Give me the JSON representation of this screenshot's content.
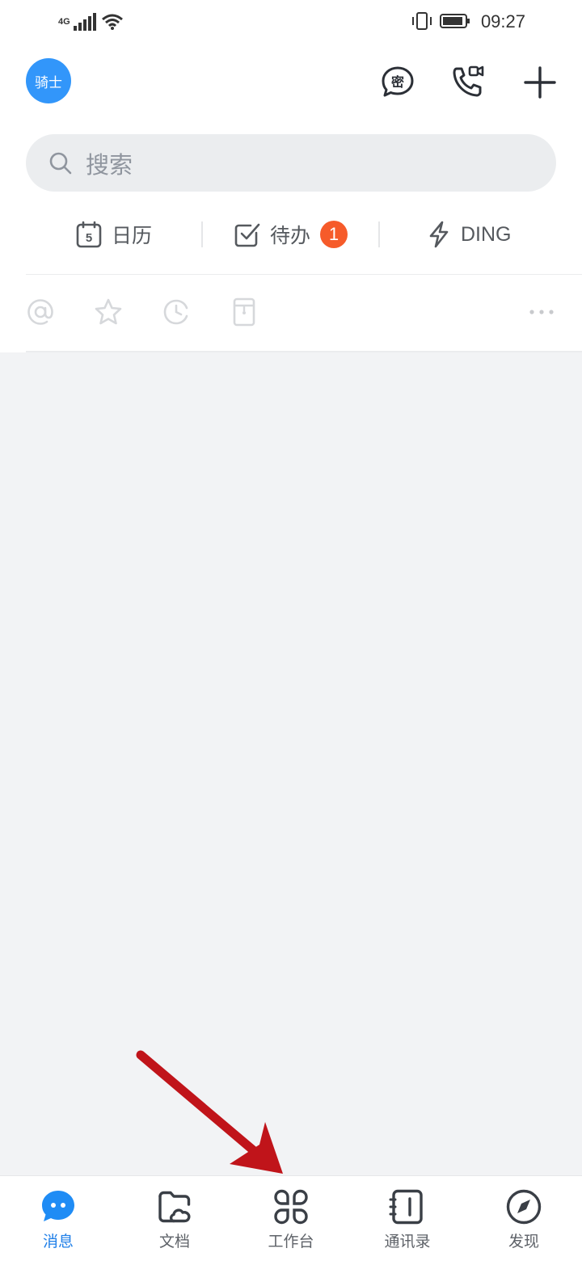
{
  "status_bar": {
    "network": "4G",
    "time": "09:27"
  },
  "header": {
    "avatar_text": "骑士",
    "icons": [
      "secret-chat-icon",
      "phone-video-icon",
      "plus-icon"
    ]
  },
  "search": {
    "placeholder": "搜索"
  },
  "quick": {
    "calendar": {
      "label": "日历",
      "icon_number": "5"
    },
    "todo": {
      "label": "待办",
      "badge": "1"
    },
    "ding": {
      "label": "DING"
    }
  },
  "filters": [
    "at-icon",
    "star-icon",
    "clock-icon",
    "bookmark-icon",
    "more-icon"
  ],
  "tabbar": {
    "items": [
      {
        "label": "消息",
        "icon": "message-icon",
        "active": true
      },
      {
        "label": "文档",
        "icon": "docs-folder-icon",
        "active": false
      },
      {
        "label": "工作台",
        "icon": "workbench-icon",
        "active": false
      },
      {
        "label": "通讯录",
        "icon": "contacts-icon",
        "active": false
      },
      {
        "label": "发现",
        "icon": "compass-icon",
        "active": false
      }
    ]
  },
  "colors": {
    "accent": "#3296fa",
    "tab_active": "#1f7fe8",
    "badge": "#f65b2a",
    "content_bg": "#f2f3f5",
    "annotation_arrow": "#c0141a"
  }
}
